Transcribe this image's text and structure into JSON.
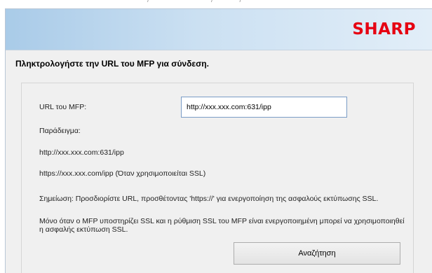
{
  "brand": {
    "logo_text": "SHARP",
    "logo_color": "#e60012"
  },
  "instruction": "Πληκτρολογήστε την URL του MFP για σύνδεση.",
  "form": {
    "url_label": "URL του MFP:",
    "url_value": "http://xxx.xxx.com:631/ipp",
    "example_label": "Παράδειγμα:",
    "example_http": "http://xxx.xxx.com:631/ipp",
    "example_https": "https://xxx.xxx.com/ipp (Όταν χρησιμοποιείται SSL)",
    "note_https": "Σημείωση: Προσδιορίστε URL, προσθέτοντας 'https://' για ενεργοποίηση της ασφαλούς εκτύπωσης SSL.",
    "note_ssl": "Μόνο όταν ο MFP υποστηρίζει SSL και η ρύθμιση SSL του MFP είναι ενεργοποιημένη μπορεί να χρησιμοποιηθεί η ασφαλής εκτύπωση SSL.",
    "search_button": "Αναζήτηση"
  }
}
